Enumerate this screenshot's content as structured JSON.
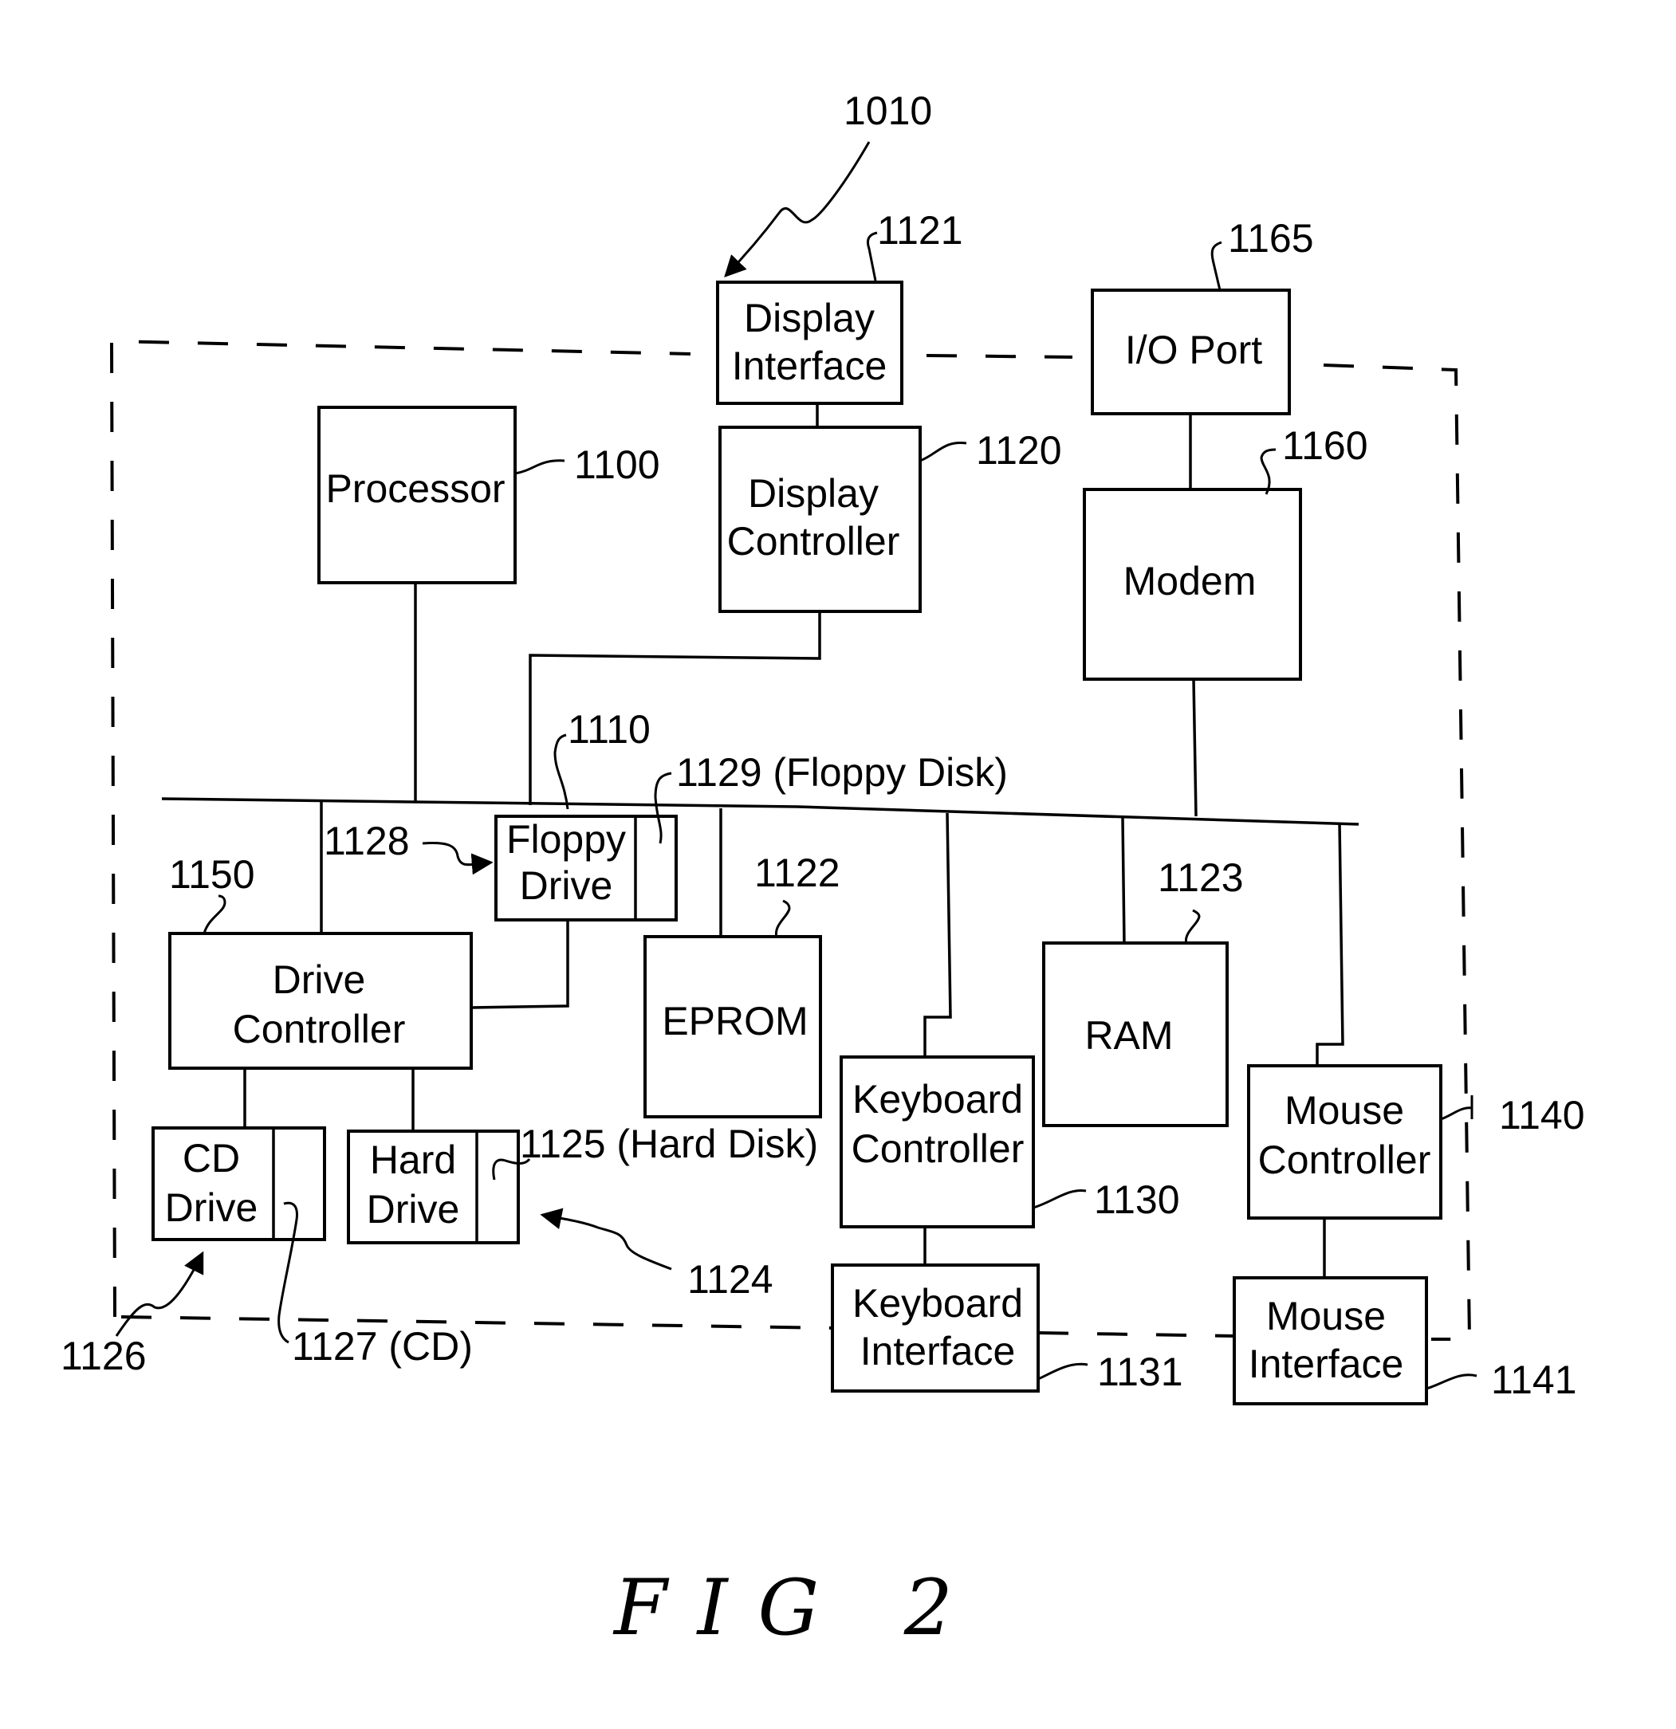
{
  "figure": {
    "caption": "FIG 2",
    "system_ref": "1010",
    "bus_ref": "1110"
  },
  "blocks": {
    "display_interface": {
      "line1": "Display",
      "line2": "Interface",
      "ref": "1121"
    },
    "io_port": {
      "line1": "I/O Port",
      "ref": "1165"
    },
    "processor": {
      "line1": "Processor",
      "ref": "1100"
    },
    "display_controller": {
      "line1": "Display",
      "line2": "Controller",
      "ref": "1120"
    },
    "modem": {
      "line1": "Modem",
      "ref": "1160"
    },
    "floppy_drive": {
      "line1": "Floppy",
      "line2": "Drive",
      "ref": "1128",
      "media_ref": "1129 (Floppy Disk)"
    },
    "drive_controller": {
      "line1": "Drive",
      "line2": "Controller",
      "ref": "1150"
    },
    "eprom": {
      "line1": "EPROM",
      "ref": "1122"
    },
    "ram": {
      "line1": "RAM",
      "ref": "1123"
    },
    "keyboard_controller": {
      "line1": "Keyboard",
      "line2": "Controller",
      "ref": "1130"
    },
    "mouse_controller": {
      "line1": "Mouse",
      "line2": "Controller",
      "ref": "1140"
    },
    "cd_drive": {
      "line1": "CD",
      "line2": "Drive",
      "ref": "1126",
      "media_ref": "1127 (CD)"
    },
    "hard_drive": {
      "line1": "Hard",
      "line2": "Drive",
      "ref": "1124",
      "media_ref": "1125 (Hard Disk)"
    },
    "keyboard_interface": {
      "line1": "Keyboard",
      "line2": "Interface",
      "ref": "1131"
    },
    "mouse_interface": {
      "line1": "Mouse",
      "line2": "Interface",
      "ref": "1141"
    }
  }
}
